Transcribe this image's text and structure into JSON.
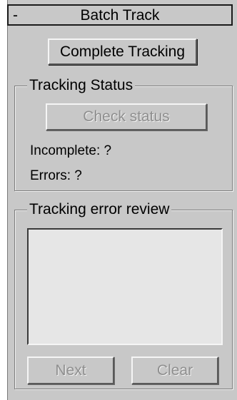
{
  "rollout": {
    "toggle": "-",
    "title": "Batch Track"
  },
  "buttons": {
    "complete_tracking": "Complete Tracking",
    "check_status": "Check status",
    "next": "Next",
    "clear": "Clear"
  },
  "tracking_status": {
    "label": "Tracking Status",
    "incomplete": "Incomplete: ?",
    "errors": "Errors: ?"
  },
  "error_review": {
    "label": "Tracking error review",
    "items": []
  }
}
